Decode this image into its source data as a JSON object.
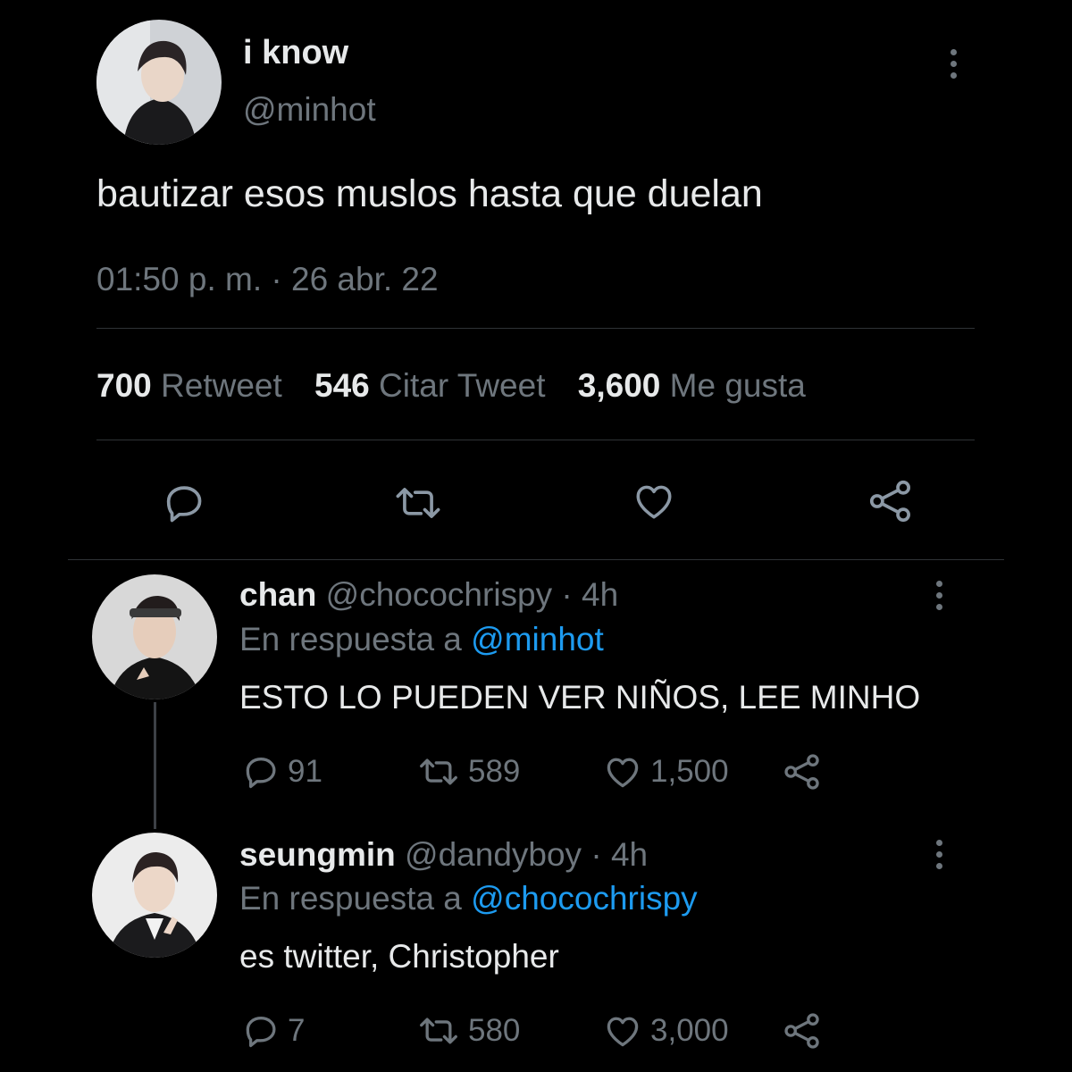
{
  "main_tweet": {
    "display_name": "i know",
    "handle": "@minhot",
    "text": "bautizar esos muslos hasta que duelan",
    "time": "01:50 p. m.",
    "separator": "·",
    "date": "26 abr. 22",
    "stats": {
      "retweets_count": "700",
      "retweets_label": "Retweet",
      "quotes_count": "546",
      "quotes_label": "Citar Tweet",
      "likes_count": "3,600",
      "likes_label": "Me gusta"
    },
    "actions": [
      "reply-icon",
      "retweet-icon",
      "like-icon",
      "share-icon"
    ]
  },
  "replies": [
    {
      "display_name": "chan",
      "handle": "@chocochrispy",
      "age": "· 4h",
      "reply_prefix": "En respuesta a",
      "reply_to": "@minhot",
      "text": "ESTO LO PUEDEN VER NIÑOS, LEE MINHO",
      "reply_count": "91",
      "retweet_count": "589",
      "like_count": "1,500"
    },
    {
      "display_name": "seungmin",
      "handle": "@dandyboy",
      "age": "· 4h",
      "reply_prefix": "En respuesta a",
      "reply_to": "@chocochrispy",
      "text": "es twitter, Christopher",
      "reply_count": "7",
      "retweet_count": "580",
      "like_count": "3,000"
    }
  ],
  "colors": {
    "background": "#000000",
    "text": "#e7e9ea",
    "secondary": "#6e767d",
    "link": "#1d9bf0",
    "divider": "#2f3336"
  }
}
